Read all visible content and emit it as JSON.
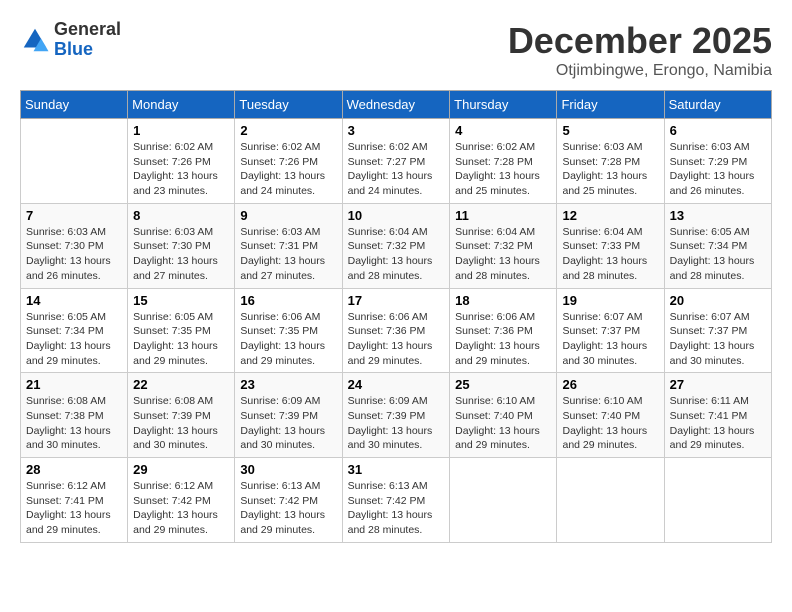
{
  "header": {
    "logo_line1": "General",
    "logo_line2": "Blue",
    "month_title": "December 2025",
    "subtitle": "Otjimbingwe, Erongo, Namibia"
  },
  "weekdays": [
    "Sunday",
    "Monday",
    "Tuesday",
    "Wednesday",
    "Thursday",
    "Friday",
    "Saturday"
  ],
  "weeks": [
    [
      {
        "day": "",
        "sunrise": "",
        "sunset": "",
        "daylight": ""
      },
      {
        "day": "1",
        "sunrise": "Sunrise: 6:02 AM",
        "sunset": "Sunset: 7:26 PM",
        "daylight": "Daylight: 13 hours and 23 minutes."
      },
      {
        "day": "2",
        "sunrise": "Sunrise: 6:02 AM",
        "sunset": "Sunset: 7:26 PM",
        "daylight": "Daylight: 13 hours and 24 minutes."
      },
      {
        "day": "3",
        "sunrise": "Sunrise: 6:02 AM",
        "sunset": "Sunset: 7:27 PM",
        "daylight": "Daylight: 13 hours and 24 minutes."
      },
      {
        "day": "4",
        "sunrise": "Sunrise: 6:02 AM",
        "sunset": "Sunset: 7:28 PM",
        "daylight": "Daylight: 13 hours and 25 minutes."
      },
      {
        "day": "5",
        "sunrise": "Sunrise: 6:03 AM",
        "sunset": "Sunset: 7:28 PM",
        "daylight": "Daylight: 13 hours and 25 minutes."
      },
      {
        "day": "6",
        "sunrise": "Sunrise: 6:03 AM",
        "sunset": "Sunset: 7:29 PM",
        "daylight": "Daylight: 13 hours and 26 minutes."
      }
    ],
    [
      {
        "day": "7",
        "sunrise": "Sunrise: 6:03 AM",
        "sunset": "Sunset: 7:30 PM",
        "daylight": "Daylight: 13 hours and 26 minutes."
      },
      {
        "day": "8",
        "sunrise": "Sunrise: 6:03 AM",
        "sunset": "Sunset: 7:30 PM",
        "daylight": "Daylight: 13 hours and 27 minutes."
      },
      {
        "day": "9",
        "sunrise": "Sunrise: 6:03 AM",
        "sunset": "Sunset: 7:31 PM",
        "daylight": "Daylight: 13 hours and 27 minutes."
      },
      {
        "day": "10",
        "sunrise": "Sunrise: 6:04 AM",
        "sunset": "Sunset: 7:32 PM",
        "daylight": "Daylight: 13 hours and 28 minutes."
      },
      {
        "day": "11",
        "sunrise": "Sunrise: 6:04 AM",
        "sunset": "Sunset: 7:32 PM",
        "daylight": "Daylight: 13 hours and 28 minutes."
      },
      {
        "day": "12",
        "sunrise": "Sunrise: 6:04 AM",
        "sunset": "Sunset: 7:33 PM",
        "daylight": "Daylight: 13 hours and 28 minutes."
      },
      {
        "day": "13",
        "sunrise": "Sunrise: 6:05 AM",
        "sunset": "Sunset: 7:34 PM",
        "daylight": "Daylight: 13 hours and 28 minutes."
      }
    ],
    [
      {
        "day": "14",
        "sunrise": "Sunrise: 6:05 AM",
        "sunset": "Sunset: 7:34 PM",
        "daylight": "Daylight: 13 hours and 29 minutes."
      },
      {
        "day": "15",
        "sunrise": "Sunrise: 6:05 AM",
        "sunset": "Sunset: 7:35 PM",
        "daylight": "Daylight: 13 hours and 29 minutes."
      },
      {
        "day": "16",
        "sunrise": "Sunrise: 6:06 AM",
        "sunset": "Sunset: 7:35 PM",
        "daylight": "Daylight: 13 hours and 29 minutes."
      },
      {
        "day": "17",
        "sunrise": "Sunrise: 6:06 AM",
        "sunset": "Sunset: 7:36 PM",
        "daylight": "Daylight: 13 hours and 29 minutes."
      },
      {
        "day": "18",
        "sunrise": "Sunrise: 6:06 AM",
        "sunset": "Sunset: 7:36 PM",
        "daylight": "Daylight: 13 hours and 29 minutes."
      },
      {
        "day": "19",
        "sunrise": "Sunrise: 6:07 AM",
        "sunset": "Sunset: 7:37 PM",
        "daylight": "Daylight: 13 hours and 30 minutes."
      },
      {
        "day": "20",
        "sunrise": "Sunrise: 6:07 AM",
        "sunset": "Sunset: 7:37 PM",
        "daylight": "Daylight: 13 hours and 30 minutes."
      }
    ],
    [
      {
        "day": "21",
        "sunrise": "Sunrise: 6:08 AM",
        "sunset": "Sunset: 7:38 PM",
        "daylight": "Daylight: 13 hours and 30 minutes."
      },
      {
        "day": "22",
        "sunrise": "Sunrise: 6:08 AM",
        "sunset": "Sunset: 7:39 PM",
        "daylight": "Daylight: 13 hours and 30 minutes."
      },
      {
        "day": "23",
        "sunrise": "Sunrise: 6:09 AM",
        "sunset": "Sunset: 7:39 PM",
        "daylight": "Daylight: 13 hours and 30 minutes."
      },
      {
        "day": "24",
        "sunrise": "Sunrise: 6:09 AM",
        "sunset": "Sunset: 7:39 PM",
        "daylight": "Daylight: 13 hours and 30 minutes."
      },
      {
        "day": "25",
        "sunrise": "Sunrise: 6:10 AM",
        "sunset": "Sunset: 7:40 PM",
        "daylight": "Daylight: 13 hours and 29 minutes."
      },
      {
        "day": "26",
        "sunrise": "Sunrise: 6:10 AM",
        "sunset": "Sunset: 7:40 PM",
        "daylight": "Daylight: 13 hours and 29 minutes."
      },
      {
        "day": "27",
        "sunrise": "Sunrise: 6:11 AM",
        "sunset": "Sunset: 7:41 PM",
        "daylight": "Daylight: 13 hours and 29 minutes."
      }
    ],
    [
      {
        "day": "28",
        "sunrise": "Sunrise: 6:12 AM",
        "sunset": "Sunset: 7:41 PM",
        "daylight": "Daylight: 13 hours and 29 minutes."
      },
      {
        "day": "29",
        "sunrise": "Sunrise: 6:12 AM",
        "sunset": "Sunset: 7:42 PM",
        "daylight": "Daylight: 13 hours and 29 minutes."
      },
      {
        "day": "30",
        "sunrise": "Sunrise: 6:13 AM",
        "sunset": "Sunset: 7:42 PM",
        "daylight": "Daylight: 13 hours and 29 minutes."
      },
      {
        "day": "31",
        "sunrise": "Sunrise: 6:13 AM",
        "sunset": "Sunset: 7:42 PM",
        "daylight": "Daylight: 13 hours and 28 minutes."
      },
      {
        "day": "",
        "sunrise": "",
        "sunset": "",
        "daylight": ""
      },
      {
        "day": "",
        "sunrise": "",
        "sunset": "",
        "daylight": ""
      },
      {
        "day": "",
        "sunrise": "",
        "sunset": "",
        "daylight": ""
      }
    ]
  ]
}
